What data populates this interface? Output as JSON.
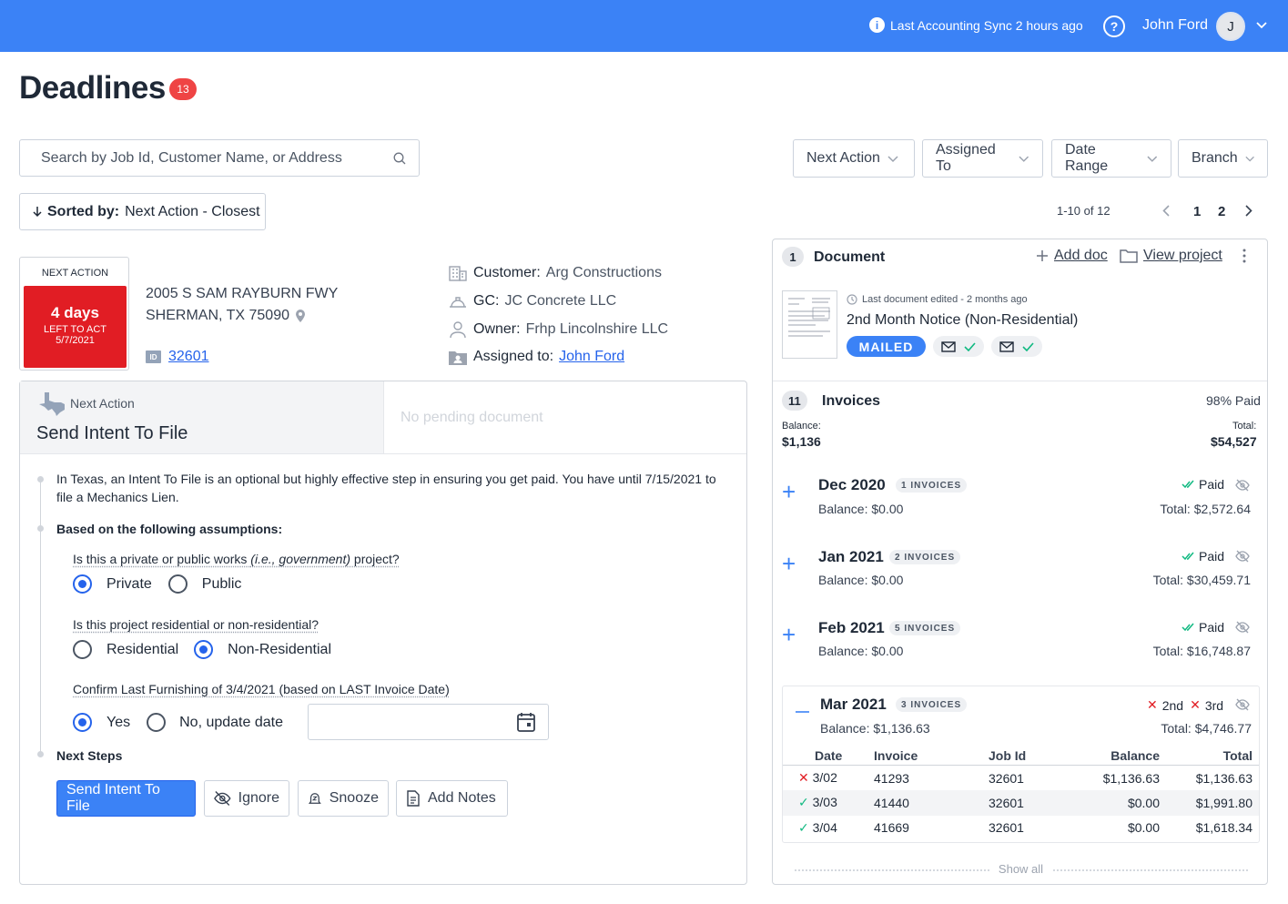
{
  "topbar": {
    "sync_text": "Last Accounting Sync 2 hours ago",
    "user_name": "John Ford",
    "avatar_initial": "J",
    "color": "#3b82f6"
  },
  "page": {
    "title": "Deadlines",
    "count": "13"
  },
  "search": {
    "placeholder": "Search by Job Id, Customer Name, or Address"
  },
  "filters": [
    "Next Action",
    "Assigned To",
    "Date Range",
    "Branch"
  ],
  "sort": {
    "label": "Sorted by:",
    "value": "Next Action - Closest"
  },
  "pagination": {
    "range": "1-10 of 12",
    "pages": [
      "1",
      "2"
    ]
  },
  "job": {
    "next_action_label": "NEXT ACTION",
    "days": "4 days",
    "left_to_act": "LEFT TO ACT",
    "date": "5/7/2021",
    "address_line1": "2005 S SAM RAYBURN FWY",
    "address_line2": "SHERMAN, TX 75090",
    "id_badge": "ID",
    "job_id": "32601",
    "customer_label": "Customer:",
    "customer": "Arg Constructions",
    "gc_label": "GC:",
    "gc": "JC Concrete LLC",
    "owner_label": "Owner:",
    "owner": "Frhp Lincolnshire LLC",
    "assigned_label": "Assigned to:",
    "assigned": "John Ford"
  },
  "action_panel": {
    "small_label": "Next Action",
    "title": "Send Intent To File",
    "no_pending": "No pending document",
    "intro": "In Texas, an Intent To File is an optional but highly effective step in ensuring you get paid. You have until 7/15/2021 to file a Mechanics Lien.",
    "assumptions_label": "Based on the following assumptions:",
    "q1_a": "Is this a private or public works ",
    "q1_em": "(i.e., government)",
    "q1_b": " project?",
    "q1_options": [
      "Private",
      "Public"
    ],
    "q2": "Is this project residential or non-residential?",
    "q2_options": [
      "Residential",
      "Non-Residential"
    ],
    "q3": "Confirm Last Furnishing of 3/4/2021 (based on LAST Invoice Date)",
    "q3_options": [
      "Yes",
      "No, update date"
    ],
    "next_steps_label": "Next Steps",
    "buttons": {
      "send": "Send Intent To File",
      "ignore": "Ignore",
      "snooze": "Snooze",
      "notes": "Add Notes"
    }
  },
  "document": {
    "count": "1",
    "title": "Document",
    "add_doc": "Add doc",
    "view_project": "View project",
    "last_edited": "Last document edited - 2 months ago",
    "name": "2nd Month Notice (Non-Residential)",
    "status": "MAILED"
  },
  "invoices": {
    "count": "11",
    "title": "Invoices",
    "paid_pct": "98% Paid",
    "balance_label": "Balance:",
    "balance": "$1,136",
    "total_label": "Total:",
    "total": "$54,527",
    "months": [
      {
        "name": "Dec 2020",
        "pill": "1 INVOICES",
        "status": "Paid",
        "balance": "Balance: $0.00",
        "total": "Total: $2,572.64"
      },
      {
        "name": "Jan 2021",
        "pill": "2 INVOICES",
        "status": "Paid",
        "balance": "Balance: $0.00",
        "total": "Total: $30,459.71"
      },
      {
        "name": "Feb 2021",
        "pill": "5 INVOICES",
        "status": "Paid",
        "balance": "Balance: $0.00",
        "total": "Total: $16,748.87"
      }
    ],
    "march": {
      "name": "Mar 2021",
      "pill": "3 INVOICES",
      "notice_2": "2nd",
      "notice_3": "3rd",
      "balance": "Balance: $1,136.63",
      "total": "Total: $4,746.77",
      "headers": [
        "Date",
        "Invoice",
        "Job Id",
        "Balance",
        "Total"
      ],
      "rows": [
        {
          "status": "unpaid",
          "date": "3/02",
          "invoice": "41293",
          "job": "32601",
          "balance": "$1,136.63",
          "total": "$1,136.63"
        },
        {
          "status": "paid",
          "date": "3/03",
          "invoice": "41440",
          "job": "32601",
          "balance": "$0.00",
          "total": "$1,991.80"
        },
        {
          "status": "paid",
          "date": "3/04",
          "invoice": "41669",
          "job": "32601",
          "balance": "$0.00",
          "total": "$1,618.34"
        }
      ]
    },
    "show_all": "Show all"
  }
}
